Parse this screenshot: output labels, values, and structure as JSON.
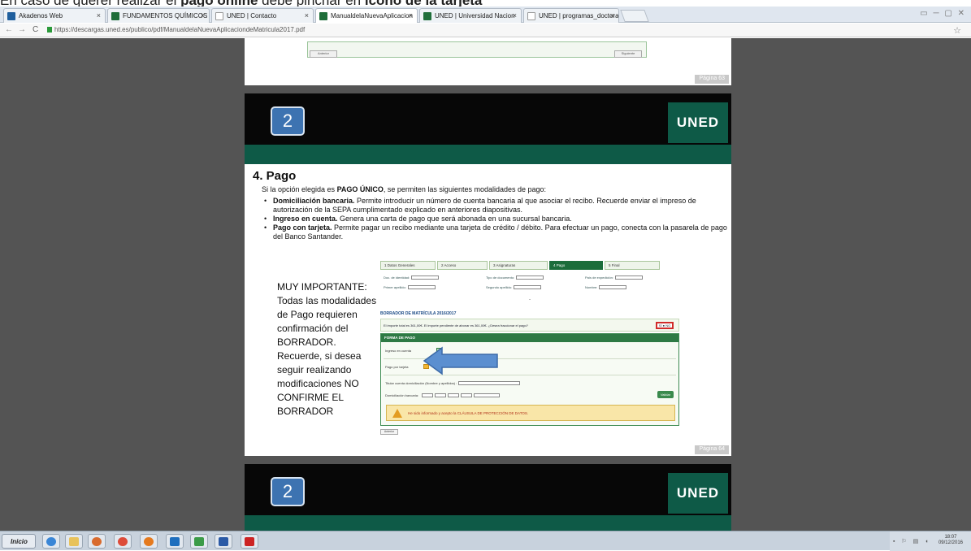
{
  "caption": {
    "prefix": "En caso de querer realizar el ",
    "bold1": "pago online",
    "middle": " debe  pinchar en ",
    "bold2": "icono de la tarjeta"
  },
  "browser": {
    "tabs": [
      {
        "label": "Akadenos Web",
        "color": "#1f5f9e"
      },
      {
        "label": "FUNDAMENTOS QUÍMICOS",
        "color": "#1f6e3a"
      },
      {
        "label": "UNED | Contacto",
        "color": "#9a9a9a"
      },
      {
        "label": "ManualdelaNuevaAplicacion",
        "color": "#1f6e3a"
      },
      {
        "label": "UNED | Universidad Nacion",
        "color": "#1f6e3a"
      },
      {
        "label": "UNED | programas_doctora",
        "color": "#9a9a9a"
      }
    ],
    "url": "https://descargas.uned.es/publico/pdf/ManualdelaNuevaAplicaciondeMatricula2017.pdf"
  },
  "prev_page": {
    "label": "Página 63",
    "btn_left": "Anterior",
    "btn_right": "Siguiente"
  },
  "slide": {
    "number": "2",
    "logo": "UNED",
    "heading": "4. Pago",
    "intro_prefix": "Si la opción elegida es ",
    "intro_bold": "PAGO ÚNICO",
    "intro_suffix": ", se permiten las siguientes modalidades de pago:",
    "bullets": [
      {
        "bold": "Domiciliación bancaria.",
        "text": " Permite introducir un número de cuenta bancaria al que asociar el recibo. Recuerde enviar el impreso de autorización de la SEPA cumplimentado explicado en anteriores diapositivas."
      },
      {
        "bold": "Ingreso en cuenta.",
        "text": " Genera una carta de pago que será abonada en una sucursal bancaria."
      },
      {
        "bold": "Pago con tarjeta.",
        "text": " Permite pagar un recibo mediante una tarjeta de crédito / débito. Para efectuar un pago, conecta con la pasarela de pago del Banco Santander."
      }
    ],
    "note": "MUY IMPORTANTE: Todas las modalidades de Pago requieren confirmación del BORRADOR. Recuerde, si desea seguir realizando modificaciones NO CONFIRME EL BORRADOR",
    "page_label": "Página 64"
  },
  "embed": {
    "steps": [
      "1 Datos Generales",
      "2 Acceso",
      "3 Asignaturas",
      "4 Pago",
      "5 Final"
    ],
    "fields_row1": [
      "Doc. de identidad:",
      "Tipo de documento:",
      "País de expedición:"
    ],
    "fields_row2": [
      "Primer apellido:",
      "Segundo apellido:",
      "Nombre:"
    ],
    "borrador_title": "BORRADOR DE MATRÍCULA 2016/2017",
    "importe_text": "El importe total es 361,00€. El importe pendiente de abonar es 361,00€. ¿Desea fraccionar el pago?",
    "si_no": "SÍ  ● NO",
    "form_header": "FORMA DE PAGO",
    "opt_ingreso": "Ingreso en cuenta",
    "opt_tarjeta": "Pago por tarjeta",
    "titular_label": "Titular cuenta domiciliación (Nombre y apellidos) :",
    "domiciliacion_label": "Domiciliación bancaria:",
    "validar": "Validar",
    "warning": "He sido informado y acepto la CLÁUSULA DE PROTECCIÓN DE DATOS.",
    "anterior": "Anterior"
  },
  "next_slide": {
    "number": "2",
    "logo": "UNED"
  },
  "taskbar": {
    "start": "Inicio",
    "time": "18:07",
    "date": "09/12/2016",
    "apps": [
      {
        "name": "ie",
        "color": "#3a86d6"
      },
      {
        "name": "folder",
        "color": "#e8c25b"
      },
      {
        "name": "media",
        "color": "#d96b2e"
      },
      {
        "name": "chrome",
        "color": "#dd4b39"
      },
      {
        "name": "firefox",
        "color": "#e57a1e"
      },
      {
        "name": "outlook",
        "color": "#1f6fbe"
      },
      {
        "name": "app-green",
        "color": "#3b9b48"
      },
      {
        "name": "word",
        "color": "#2b5aa6"
      },
      {
        "name": "acrobat",
        "color": "#cc2323"
      }
    ]
  },
  "colors": {
    "uned_green": "#0e5a47",
    "badge_blue": "#3d73b1",
    "arrow_blue": "#5b8fd0"
  }
}
